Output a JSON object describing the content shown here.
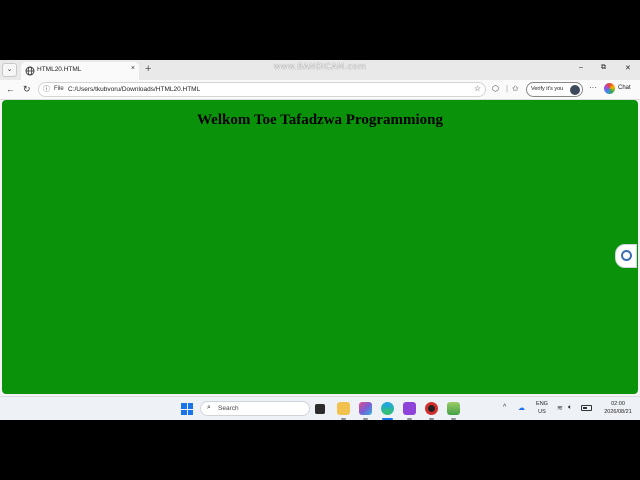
{
  "watermark": "www.BANDICAM.com",
  "browser": {
    "tab": {
      "title": "HTML20.HTML",
      "close": "×"
    },
    "new_tab": "+",
    "window_controls": {
      "minimize": "–",
      "restore": "⧉",
      "close": "✕"
    },
    "nav": {
      "back": "←",
      "refresh": "↻"
    },
    "address": {
      "label": "File",
      "url": "C:/Users/tkubvoru/Downloads/HTML20.HTML"
    },
    "verify_label": "Verify it's you",
    "more": "···",
    "chat_label": "Chat"
  },
  "page": {
    "heading": "Welkom Toe Tafadzwa Programmiong",
    "background_color": "#0a930a"
  },
  "taskbar": {
    "search_placeholder": "Search",
    "tray": {
      "language": "ENG",
      "region": "US",
      "time": "02:00",
      "date": "2026/08/21"
    },
    "tray_chevron": "^"
  },
  "icons": {
    "tab_list": "chevron-down-icon",
    "tab_favicon": "globe-icon",
    "back": "back-arrow-icon",
    "refresh": "refresh-icon",
    "site_info": "info-icon",
    "favorite": "star-icon",
    "extensions": "puzzle-icon",
    "favorites_bar": "favorites-icon",
    "copilot_side": "copilot-icon",
    "start": "windows-start-icon",
    "search": "search-icon",
    "wifi": "wifi-icon",
    "volume": "volume-icon",
    "battery": "battery-icon"
  }
}
